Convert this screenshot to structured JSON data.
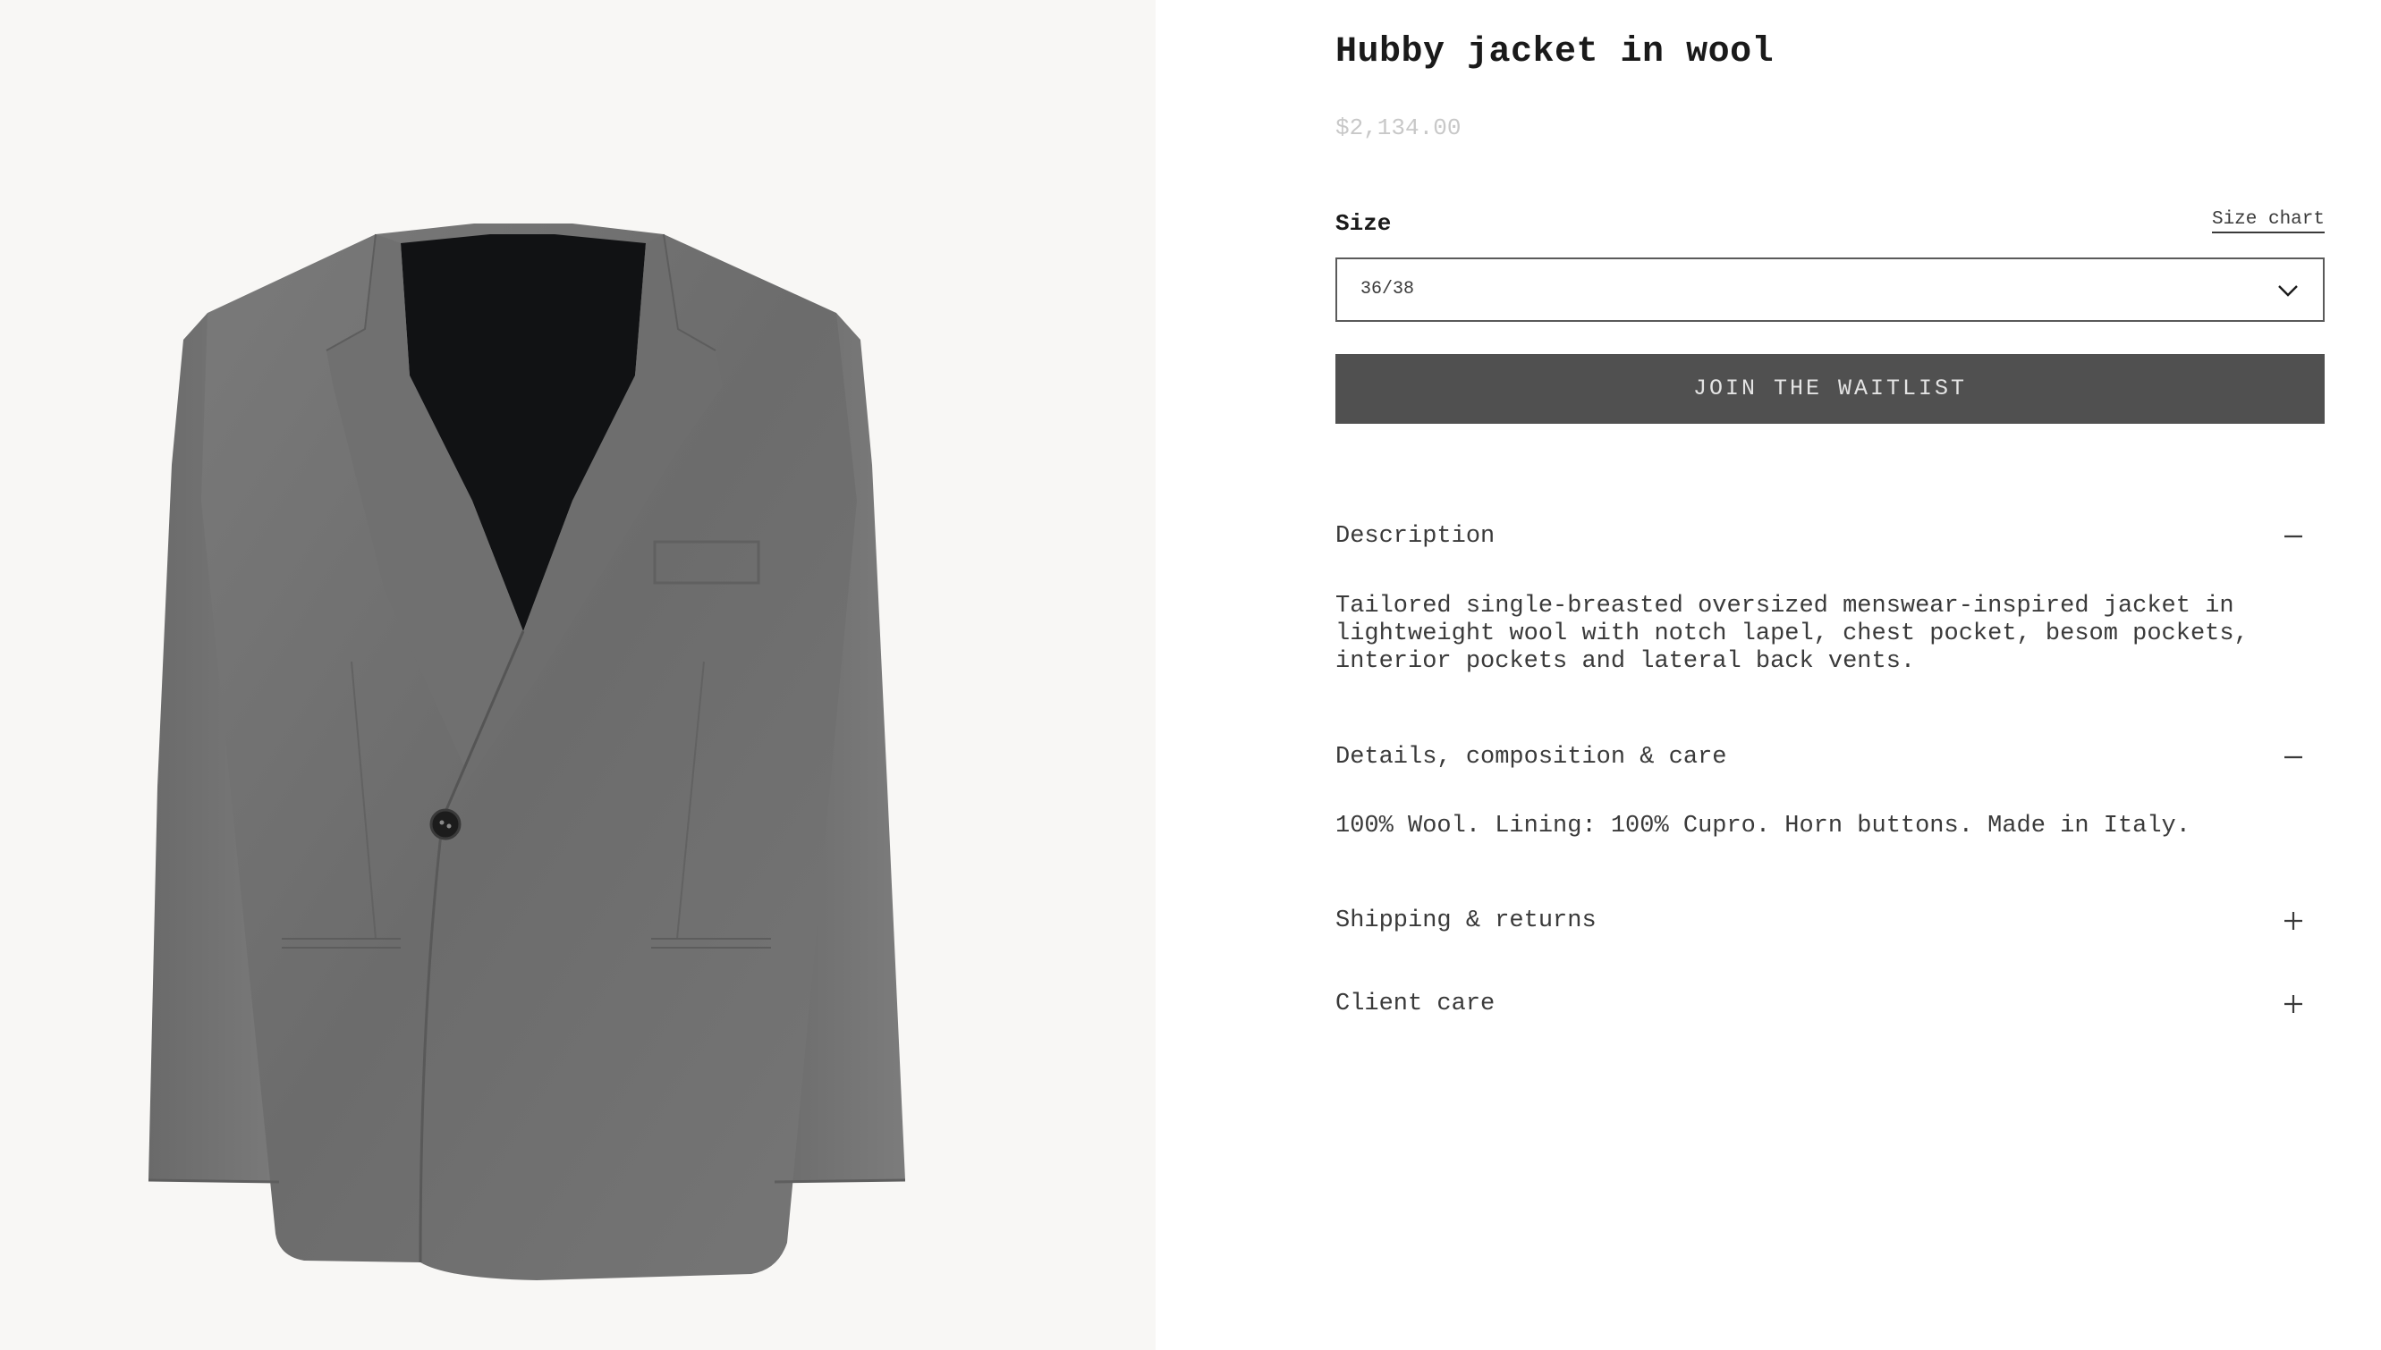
{
  "product": {
    "title": "Hubby jacket in wool",
    "price": "$2,134.00",
    "image_alt": "grey wool jacket"
  },
  "size": {
    "label": "Size",
    "chart_link": "Size chart",
    "selected": "36/38"
  },
  "cta": {
    "label": "JOIN THE WAITLIST"
  },
  "accordion": {
    "description": {
      "label": "Description",
      "state_icon": "minus-icon",
      "body": "Tailored single-breasted oversized menswear-inspired jacket in lightweight wool with notch lapel, chest pocket, besom pockets, interior pockets and lateral back vents."
    },
    "details": {
      "label": "Details, composition & care",
      "state_icon": "minus-icon",
      "body": "100% Wool. Lining: 100% Cupro. Horn buttons. Made in Italy."
    },
    "shipping": {
      "label": "Shipping & returns",
      "state_icon": "plus-icon"
    },
    "client_care": {
      "label": "Client care",
      "state_icon": "plus-icon"
    }
  },
  "colors": {
    "button_bg": "#505050",
    "price": "#c8c8c8",
    "image_bg": "#f8f7f5"
  }
}
